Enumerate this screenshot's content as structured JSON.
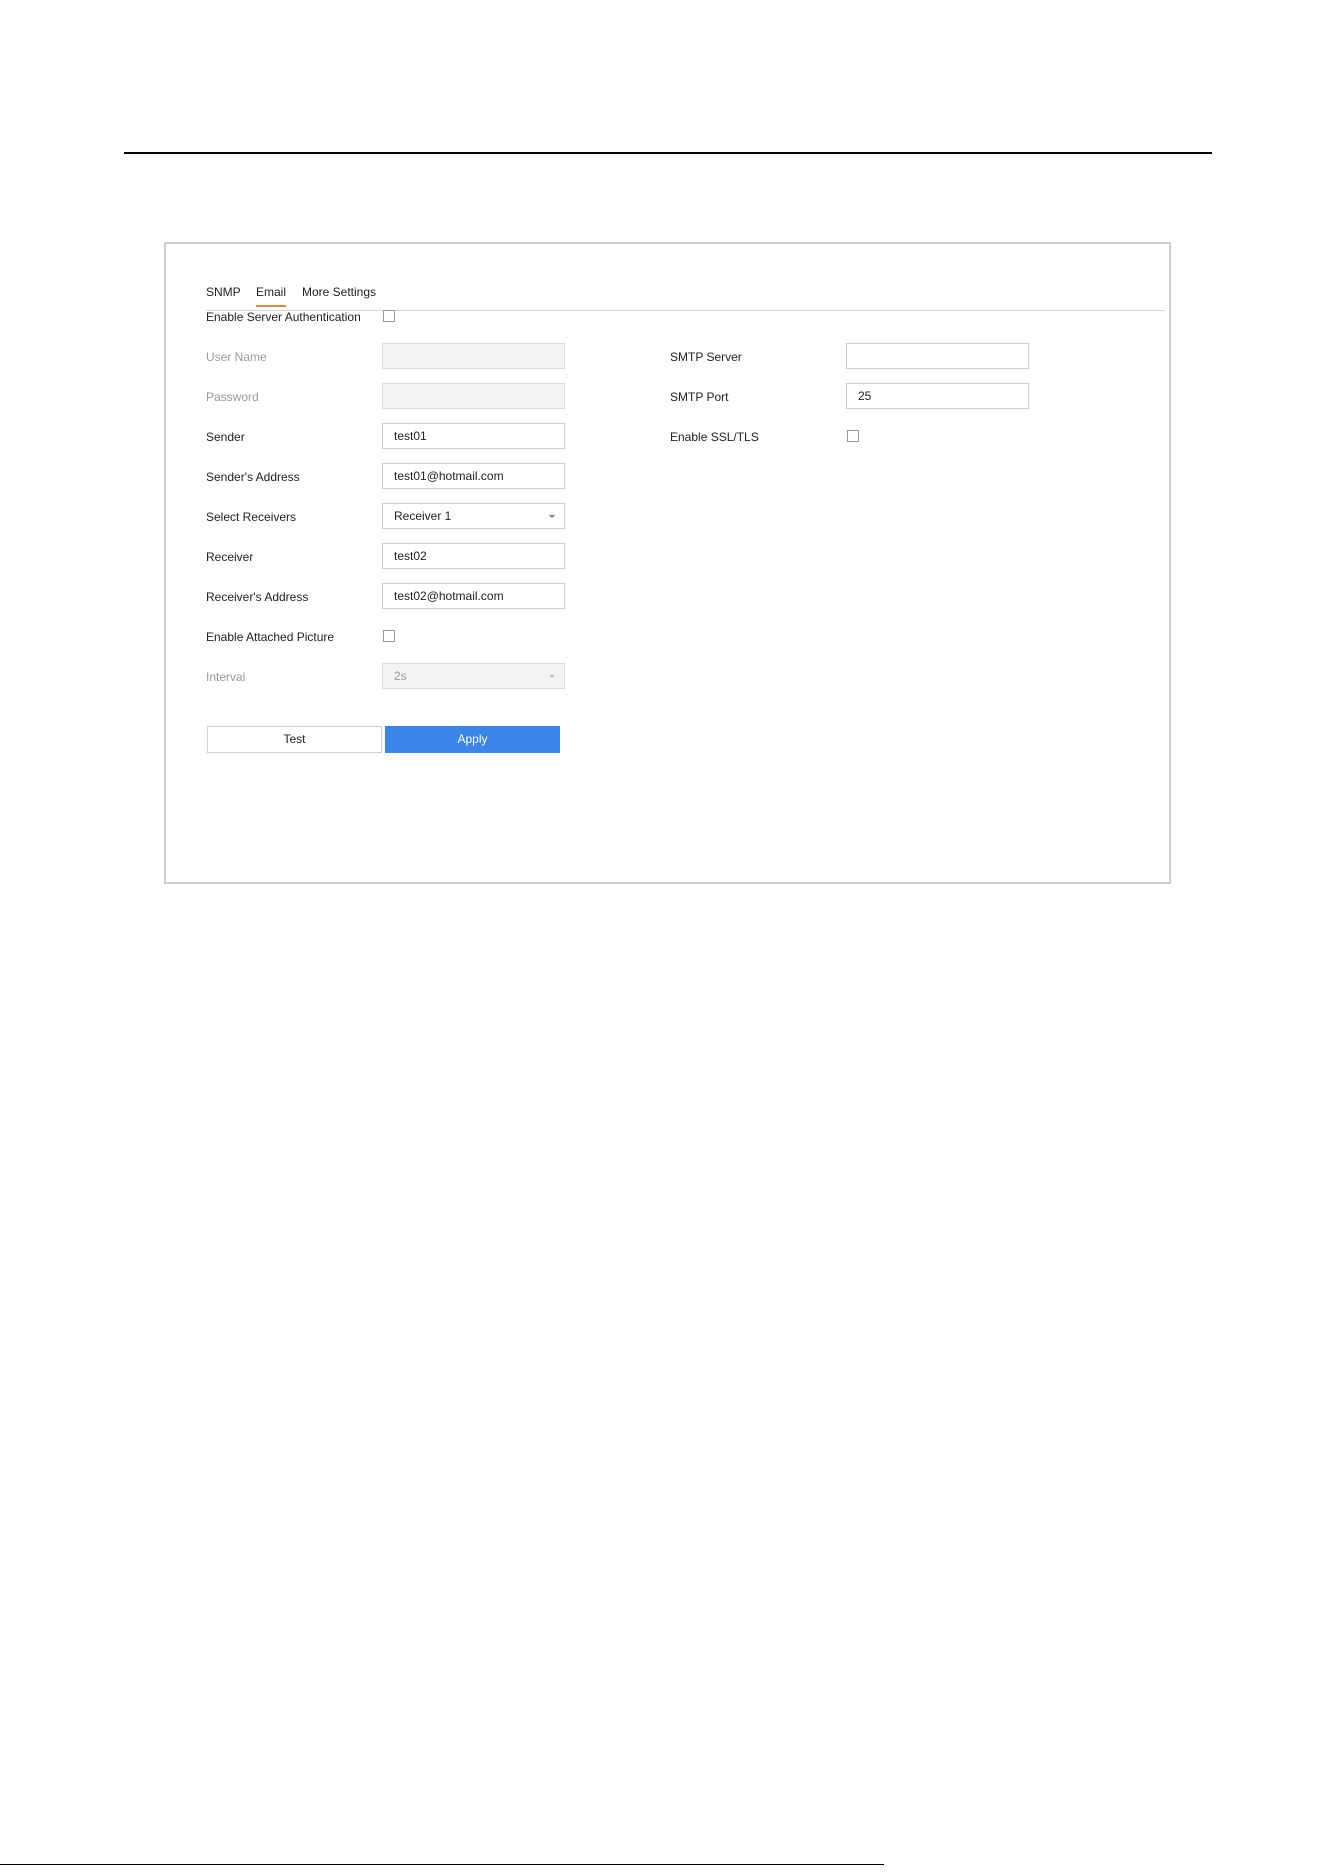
{
  "tabs": [
    {
      "label": "SNMP",
      "active": false
    },
    {
      "label": "Email",
      "active": true
    },
    {
      "label": "More Settings",
      "active": false
    }
  ],
  "form": {
    "enable_server_auth": {
      "label": "Enable Server Authentication",
      "checked": false
    },
    "user_name": {
      "label": "User Name",
      "value": "",
      "disabled": true
    },
    "password": {
      "label": "Password",
      "value": "",
      "disabled": true
    },
    "sender": {
      "label": "Sender",
      "value": "test01"
    },
    "sender_address": {
      "label": "Sender's Address",
      "value": "test01@hotmail.com"
    },
    "select_receivers": {
      "label": "Select Receivers",
      "value": "Receiver 1"
    },
    "receiver": {
      "label": "Receiver",
      "value": "test02"
    },
    "receiver_address": {
      "label": "Receiver's Address",
      "value": "test02@hotmail.com"
    },
    "enable_attached_picture": {
      "label": "Enable Attached Picture",
      "checked": false
    },
    "interval": {
      "label": "Interval",
      "value": "2s",
      "disabled": true
    },
    "smtp_server": {
      "label": "SMTP Server",
      "value": ""
    },
    "smtp_port": {
      "label": "SMTP Port",
      "value": "25"
    },
    "enable_ssl_tls": {
      "label": "Enable SSL/TLS",
      "checked": false
    }
  },
  "buttons": {
    "test_label": "Test",
    "apply_label": "Apply"
  },
  "colors": {
    "accent_tab_underline": "#e8863a",
    "primary_button": "#3b85e8"
  }
}
